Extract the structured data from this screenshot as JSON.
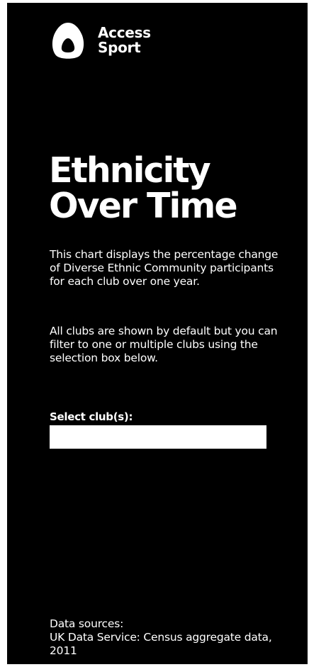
{
  "brand": {
    "logo_icon": "access-sport-logo-icon",
    "name_line1": "Access",
    "name_line2": "Sport"
  },
  "header": {
    "title_line1": "Ethnicity",
    "title_line2": "Over Time"
  },
  "description": {
    "paragraph1": "This chart displays the percentage change of Diverse Ethnic Community participants for each club over one year.",
    "paragraph2": "All clubs are shown by default but you can filter to one or multiple clubs using the selection box below."
  },
  "filter": {
    "label": "Select club(s):",
    "value": ""
  },
  "footer": {
    "sources_heading": "Data sources:",
    "source_1": "UK Data Service: Census aggregate data, 2011"
  },
  "colors": {
    "background": "#000000",
    "text": "#ffffff",
    "select_box": "#ffffff"
  }
}
